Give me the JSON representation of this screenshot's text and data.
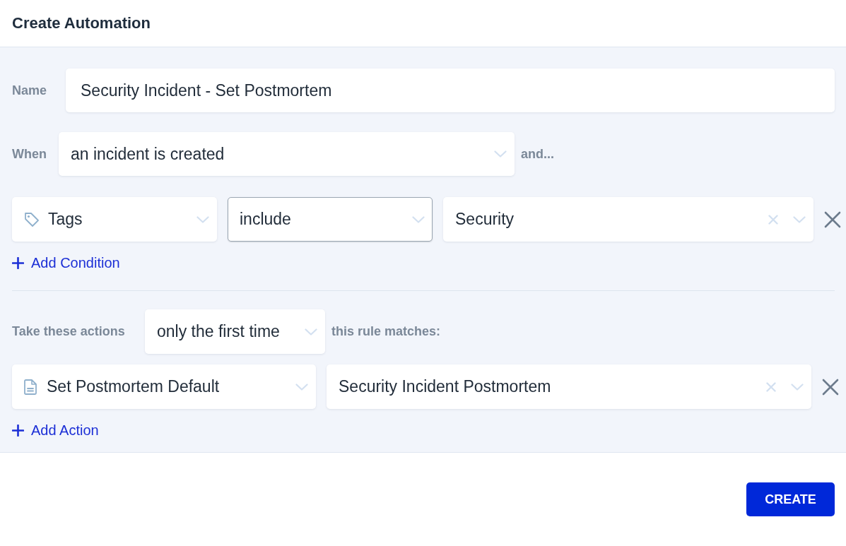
{
  "dialog": {
    "title": "Create Automation"
  },
  "name_field": {
    "label": "Name",
    "value": "Security Incident - Set Postmortem",
    "focused": false
  },
  "trigger": {
    "label": "When",
    "select": {
      "text": "an incident is created",
      "focused": false
    },
    "suffix": "and..."
  },
  "conditions": [
    {
      "field": {
        "text": "Tags",
        "focused": false
      },
      "operator": {
        "text": "include",
        "focused": true
      },
      "value": {
        "text": "Security",
        "focused": false
      }
    }
  ],
  "add_condition": {
    "label": "Add Condition"
  },
  "actions_header": {
    "label": "Take these actions",
    "frequency": {
      "text": "only the first time",
      "focused": false
    },
    "suffix": "this rule matches:"
  },
  "actions": [
    {
      "type": {
        "text": "Set Postmortem Default",
        "focused": false
      },
      "target": {
        "text": "Security Incident Postmortem",
        "focused": false
      }
    }
  ],
  "add_action": {
    "label": "Add Action"
  },
  "footer": {
    "buttons": [
      {
        "label": "CREATE",
        "kind": "primary"
      }
    ]
  }
}
